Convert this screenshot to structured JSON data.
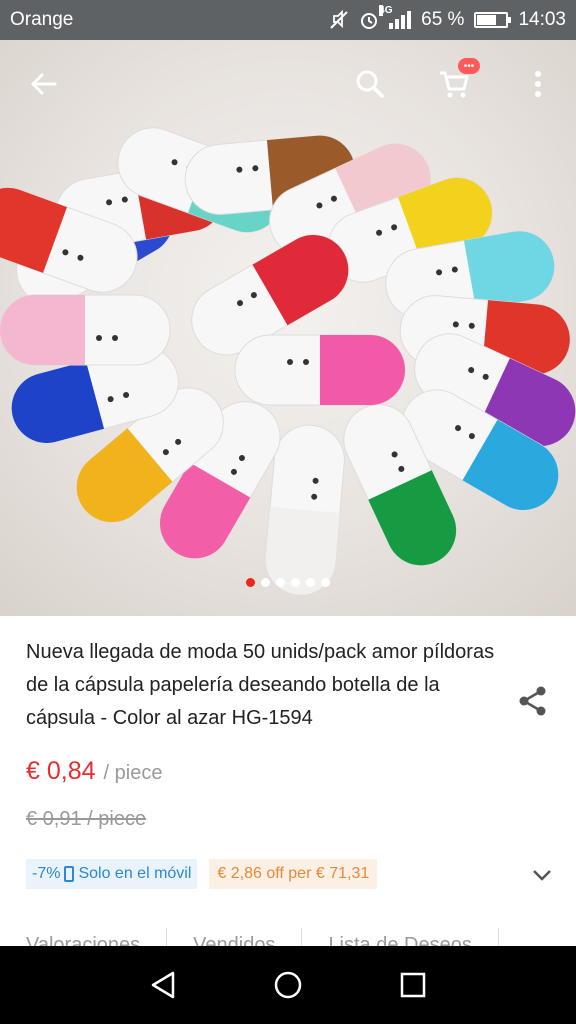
{
  "status_bar": {
    "carrier": "Orange",
    "network": "4G",
    "battery_percent": "65 %",
    "battery_level": 0.65,
    "time": "14:03"
  },
  "toolbar": {
    "back_icon": "arrow-left-icon",
    "search_icon": "search-icon",
    "cart_icon": "cart-icon",
    "cart_badge": "•••",
    "more_icon": "more-vert-icon"
  },
  "gallery": {
    "image_count": 6,
    "active_index": 0,
    "active_color": "#e8271b"
  },
  "product": {
    "title": "Nueva llegada de moda 50 unids/pack amor píldoras de la cápsula papelería deseando botella de la cápsula - Color al azar HG-1594",
    "price": "€ 0,84",
    "price_unit": "/ piece",
    "old_price": "€ 0,91 / piece",
    "price_color": "#e62e2e"
  },
  "promos": {
    "discount": "-7%",
    "mobile_only": "Solo en el móvil",
    "coupon": "€ 2,86 off per € 71,31"
  },
  "tabs": [
    {
      "label": "Valoraciones"
    },
    {
      "label": "Vendidos"
    },
    {
      "label": "Lista de Deseos"
    }
  ],
  "nav_bar": {
    "back": "triangle-back-icon",
    "home": "circle-home-icon",
    "recents": "square-recents-icon"
  }
}
